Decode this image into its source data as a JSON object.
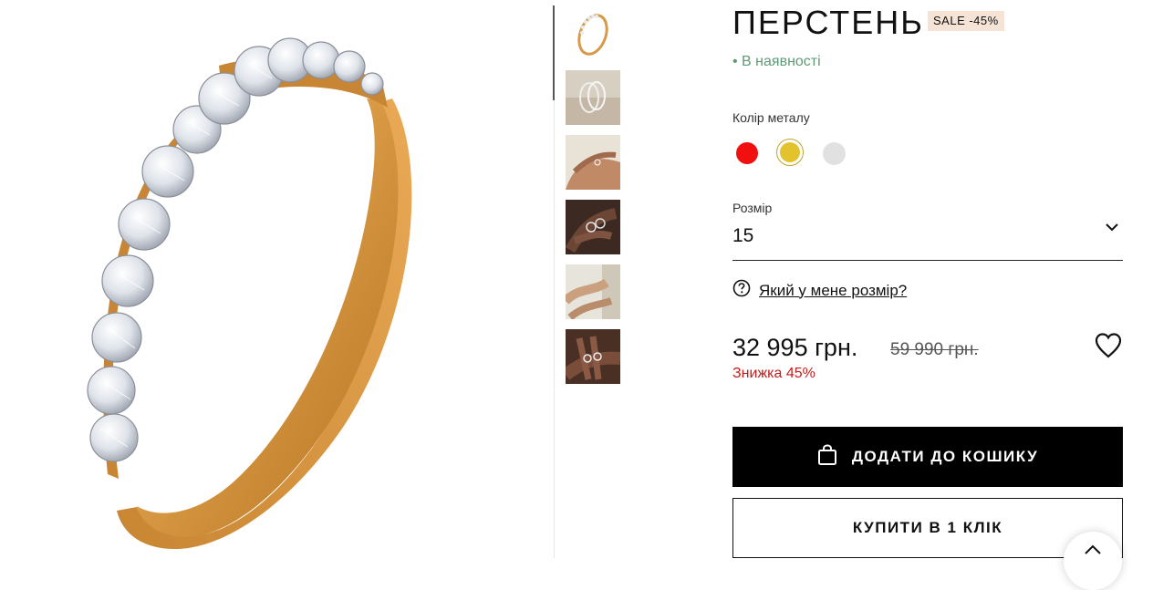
{
  "product": {
    "title": "ПЕРСТЕНЬ",
    "badge": "SALE -45%",
    "stock": "• В наявності"
  },
  "options": {
    "metal_label": "Колір металу",
    "metal_colors": [
      "#f01010",
      "#e3c32d",
      "#e1e1e1"
    ],
    "size_label": "Розмір",
    "size_value": "15",
    "size_help": "Який у мене розмір?"
  },
  "pricing": {
    "price": "32 995 грн.",
    "old_price": "59 990 грн.",
    "discount": "Знижка 45%"
  },
  "actions": {
    "add_to_cart": "ДОДАТИ ДО КОШИКУ",
    "buy_one_click": "КУПИТИ В 1 КЛІК"
  },
  "icons": {
    "cart": "shopping-bag-icon",
    "wishlist": "heart-icon",
    "size_help": "question-circle-icon",
    "dropdown": "chevron-down-icon"
  }
}
